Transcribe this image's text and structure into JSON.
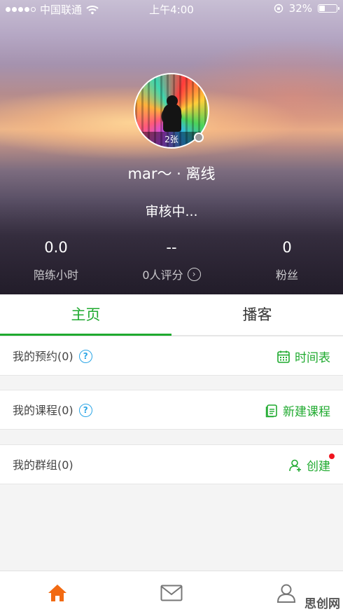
{
  "status_bar": {
    "carrier": "中国联通",
    "time": "上午4:00",
    "battery_percent": "32%",
    "battery_level": 0.32,
    "icons": [
      "signal-dots-icon",
      "wifi-icon",
      "orientation-lock-icon",
      "battery-icon"
    ]
  },
  "profile": {
    "photo_count_label": "2张",
    "name_line": "mar～ · 离线",
    "review_status": "审核中...",
    "presence_color": "#9a9a9a"
  },
  "stats": [
    {
      "value": "0.0",
      "label": "陪练小时"
    },
    {
      "value": "--",
      "label": "0人评分"
    },
    {
      "value": "0",
      "label": "粉丝"
    }
  ],
  "tabs": [
    {
      "label": "主页",
      "active": true
    },
    {
      "label": "播客",
      "active": false
    }
  ],
  "sections": {
    "reservations": {
      "label": "我的预约(0)",
      "action": "时间表"
    },
    "courses": {
      "label": "我的课程(0)",
      "action": "新建课程"
    },
    "groups": {
      "label": "我的群组(0)",
      "action": "创建"
    }
  },
  "bottom_nav": {
    "items": [
      "home-icon",
      "mail-icon",
      "profile-icon"
    ],
    "active_color": "#f26a12"
  },
  "watermark": "思创网",
  "colors": {
    "accent": "#1faa2f",
    "help": "#2aa5e6",
    "notification": "#f0141e"
  }
}
